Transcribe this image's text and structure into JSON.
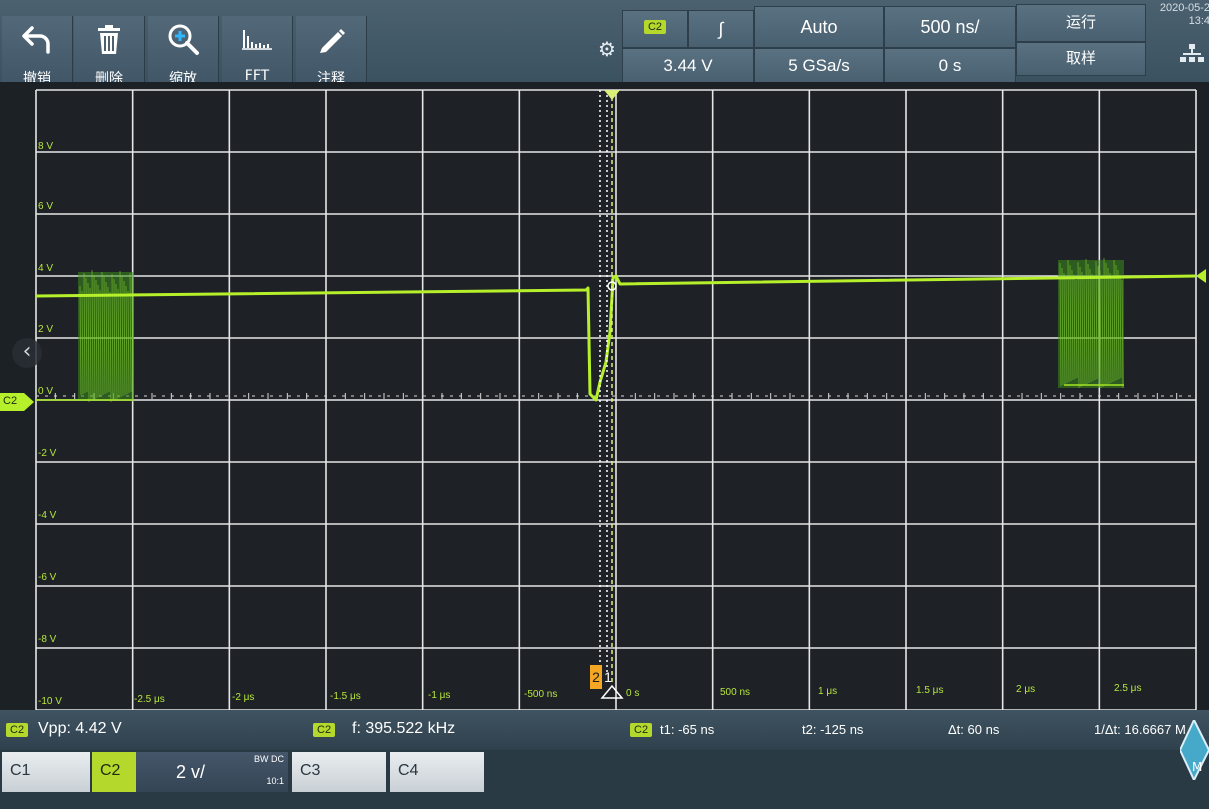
{
  "toolbar": {
    "buttons": [
      {
        "label": "撤销",
        "icon": "undo-icon"
      },
      {
        "label": "删除",
        "icon": "trash-icon"
      },
      {
        "label": "缩放",
        "icon": "zoom-icon"
      },
      {
        "label": "FFT",
        "icon": "fft-icon"
      },
      {
        "label": "注释",
        "icon": "pencil-icon"
      }
    ],
    "settings_icon": "gear-icon"
  },
  "trigger": {
    "channel": "C2",
    "edge": "∫",
    "level": "3.44 V",
    "mode": "Auto",
    "sample_rate": "5 GSa/s"
  },
  "timebase": {
    "scale": "500 ns/",
    "offset": "0 s"
  },
  "acquisition": {
    "run_state": "运行",
    "mode": "取样"
  },
  "datetime": {
    "date": "2020-05-2",
    "time": "13:4"
  },
  "graticule": {
    "volt_labels": [
      "8 V",
      "6 V",
      "4 V",
      "2 V",
      "0 V",
      "-2 V",
      "-4 V",
      "-6 V",
      "-8 V",
      "-10 V"
    ],
    "time_labels": [
      "-2.5 μs",
      "-2 μs",
      "-1.5 μs",
      "-1 μs",
      "-500 ns",
      "0 s",
      "500 ns",
      "1 μs",
      "1.5 μs",
      "2 μs",
      "2.5 μs"
    ],
    "channel_marker": "C2",
    "cursor_labels": [
      "2",
      "1"
    ],
    "trace_color": "#b6f02a"
  },
  "measurements": {
    "vpp_channel": "C2",
    "vpp": "Vpp: 4.42 V",
    "freq_channel": "C2",
    "freq": "f: 395.522 kHz",
    "cursor_channel": "C2",
    "t1": "t1: -65 ns",
    "t2": "t2: -125 ns",
    "dt": "Δt: 60 ns",
    "inv_dt": "1/Δt: 16.6667 M"
  },
  "channels": [
    {
      "name": "C1",
      "active": false
    },
    {
      "name": "C2",
      "active": true,
      "scale": "2 v/",
      "bw": "BW DC",
      "probe": "10:1"
    },
    {
      "name": "C3",
      "active": false
    },
    {
      "name": "C4",
      "active": false
    }
  ],
  "nav": {
    "left_arrow": "‹",
    "right_label": "M"
  }
}
